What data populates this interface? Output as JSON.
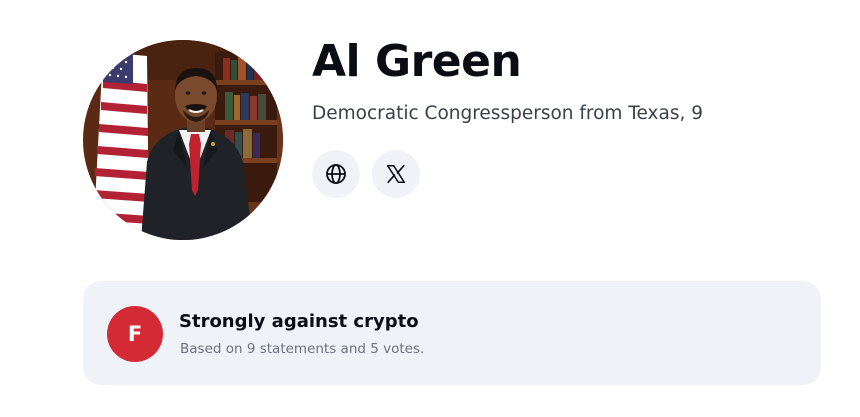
{
  "profile": {
    "name": "Al Green",
    "subtitle": "Democratic Congressperson from Texas, 9"
  },
  "social_links": [
    {
      "icon": "globe-icon"
    },
    {
      "icon": "x-logo-icon"
    }
  ],
  "stance": {
    "grade": "F",
    "title": "Strongly against crypto",
    "description": "Based on 9 statements and 5 votes."
  },
  "colors": {
    "grade_badge": "#d42a36",
    "card_background": "#eff2f7",
    "icon_button_background": "#eff2f7",
    "text_primary": "#0b0d14",
    "text_secondary": "#3b3f48",
    "text_muted": "#6b7280"
  }
}
